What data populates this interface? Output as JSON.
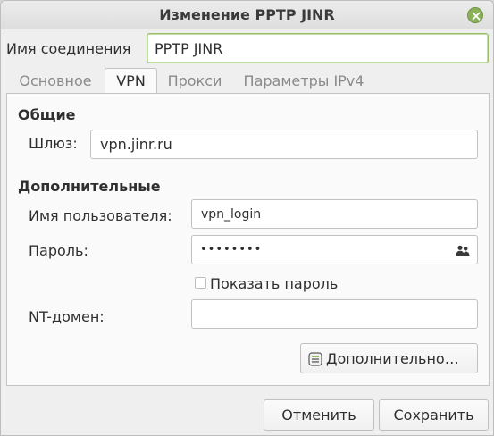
{
  "window": {
    "title": "Изменение PPTP JINR"
  },
  "connection": {
    "label": "Имя соединения",
    "value": "PPTP JINR"
  },
  "tabs": [
    {
      "label": "Основное",
      "active": false
    },
    {
      "label": "VPN",
      "active": true
    },
    {
      "label": "Прокси",
      "active": false
    },
    {
      "label": "Параметры IPv4",
      "active": false
    }
  ],
  "general": {
    "title": "Общие",
    "gateway_label": "Шлюз:",
    "gateway_value": "vpn.jinr.ru"
  },
  "additional": {
    "title": "Дополнительные",
    "username_label": "Имя пользователя:",
    "username_value": "vpn_login",
    "password_label": "Пароль:",
    "password_value": "••••••••",
    "show_password_label": "Показать пароль",
    "show_password_checked": false,
    "ntdomain_label": "NT-домен:",
    "ntdomain_value": "",
    "advanced_button": "Дополнительно…"
  },
  "footer": {
    "cancel": "Отменить",
    "save": "Сохранить"
  },
  "colors": {
    "accent": "#8bb158",
    "focus_border": "#9cbf6a"
  },
  "icons": {
    "close": "close-icon",
    "password_options": "users-icon",
    "advanced": "settings-document-icon"
  }
}
